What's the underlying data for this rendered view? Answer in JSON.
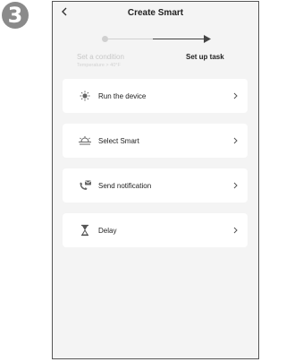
{
  "step_badge": "3",
  "header": {
    "title": "Create Smart"
  },
  "stepper": {
    "step1": {
      "label": "Set a condition",
      "sub": "Temperature > 40°F"
    },
    "step2": {
      "label": "Set up task"
    }
  },
  "tasks": [
    {
      "label": "Run the device",
      "icon": "device-icon"
    },
    {
      "label": "Select Smart",
      "icon": "scene-icon"
    },
    {
      "label": "Send notification",
      "icon": "notification-icon"
    },
    {
      "label": "Delay",
      "icon": "hourglass-icon"
    }
  ]
}
